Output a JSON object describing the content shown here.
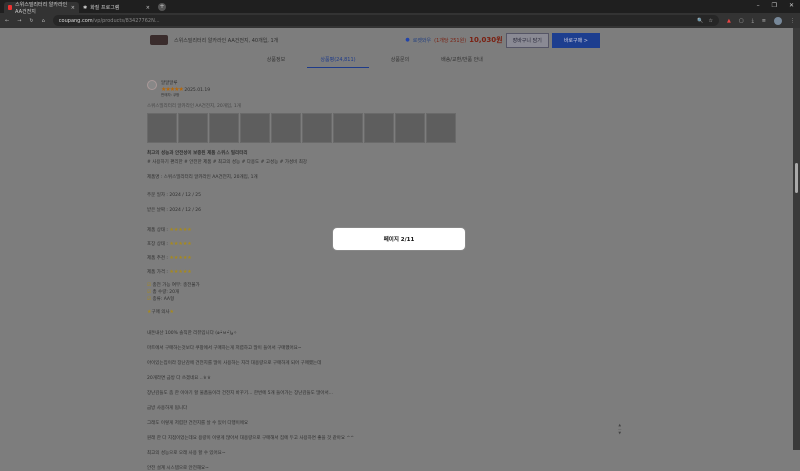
{
  "browser": {
    "tabs": [
      {
        "title": "스위스밀리터리 알카라인 AA건전지"
      },
      {
        "title": "화질 프로그램"
      }
    ],
    "new_tab": "+",
    "url_host": "coupang.com",
    "url_path": "/vp/products/83427762N..."
  },
  "sticky": {
    "product_title": "스위스밀리터리 알카라인 AA건전지, 40개입, 1개",
    "badge": "로켓와우",
    "unit_price": "(1개당 251원)",
    "price": "10,030원",
    "cart_button": "장바구니 담기",
    "buy_button": "바로구매 >"
  },
  "tabs": [
    "상품정보",
    "상품평(24,811)",
    "상품문의",
    "배송/교환/반품 안내"
  ],
  "review": {
    "reviewer": "알알알루",
    "stars": "★★★★★",
    "date": "2025.01.19",
    "seller": "판매자: 쿠팡",
    "product_option": "스위스밀리터리 알카라인 AA건전지, 20개입, 1개",
    "headline": "최고의 성능과 안전성이 보증된 제품 스위스 밀리터리",
    "tags": "# 사용하기 편리한 # 안전한 제품 # 최고의 성능 # 다용도 # 고성능 # 가성비 최강",
    "product_line": "제품명 : 스위스밀리터리 알카라인 AA건전지, 20개입, 1개",
    "order_date": "주문 일자 : 2024 / 12 / 25",
    "receive_date": "받은 날짜 : 2024 / 12 / 26",
    "ratings": [
      {
        "label": "제품 상태 :",
        "stars": "★★★★★"
      },
      {
        "label": "포장 상태 :",
        "stars": "★★★★★"
      },
      {
        "label": "제품 추천 :",
        "stars": "★★★★★"
      },
      {
        "label": "제품 가격 :",
        "stars": "★★★★★"
      }
    ],
    "checks": [
      "충전 가능 여부: 충전불가",
      "총 수량: 20개",
      "종류: AA형"
    ],
    "buy_again": "구매 의사",
    "body": [
      "내돈내산 100% 솔직한 리뷰입니다 (๑•̀ㅂ•́)و✧",
      "마트에서 구매하는것보다 쿠팡에서 구매하는게 저렴하고 많이 들어서 구매했어요~",
      "아이있는집이라 장난감에 건전지를 많이 사용하는 지라 대용량으로 구매하게 되어 구매했는데",
      "20개라면 금방 다 쓰겠네요 ..ㅎㅎ",
      "장난감들도 좀 한 이야기 할 물품들이라 건전지 바꾸기... 한번에 5개 들어가는 장난감들도 많아서...",
      "금방 사용하게 됩니다",
      "그래도 이렇게 저렴한 건전지를 살 수 있어 다행이에요",
      "원래 한 다 지점이었는데요 용량이 이렇게 많아서 대용량으로 구매해서 집에 두고 사용하면 좋을 것 같아요 ^^",
      "최고의 성능으로 오래 사용 할 수 있어요~",
      "안전 설계 시스템으로 안전해요~"
    ]
  },
  "modal": {
    "text": "페이지 2/11"
  }
}
